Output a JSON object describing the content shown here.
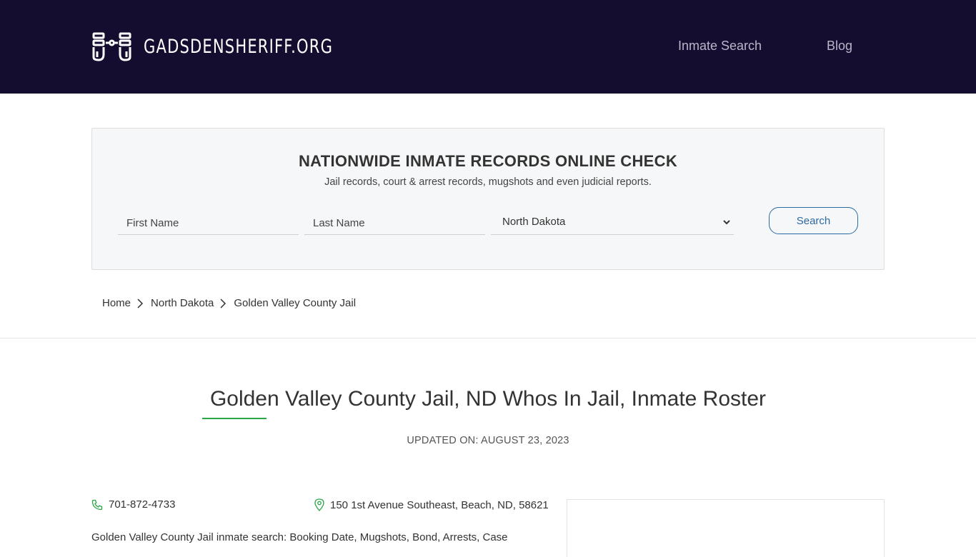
{
  "brand": {
    "logo_text": "GADSDENSHERIFF.ORG",
    "logo_icon": "handcuffs-icon"
  },
  "nav": {
    "inmate_search": "Inmate Search",
    "blog": "Blog"
  },
  "search": {
    "title": "NATIONWIDE INMATE RECORDS ONLINE CHECK",
    "subtitle": "Jail records, court & arrest records, mugshots and even judicial reports.",
    "first_name_placeholder": "First Name",
    "last_name_placeholder": "Last Name",
    "state_selected": "North Dakota",
    "button_label": "Search"
  },
  "breadcrumb": {
    "home": "Home",
    "state": "North Dakota",
    "current": "Golden Valley County Jail"
  },
  "page": {
    "title": "Golden Valley County Jail, ND Whos In Jail, Inmate Roster",
    "updated": "UPDATED ON: AUGUST 23, 2023",
    "phone": "701-872-4733",
    "address": "150 1st Avenue Southeast, Beach, ND, 58621",
    "description": "Golden Valley County Jail inmate search: Booking Date, Mugshots, Bond, Arrests, Case"
  },
  "colors": {
    "header_bg": "#150d2f",
    "accent_green": "#28a745",
    "button_blue": "#2d6aa0"
  }
}
